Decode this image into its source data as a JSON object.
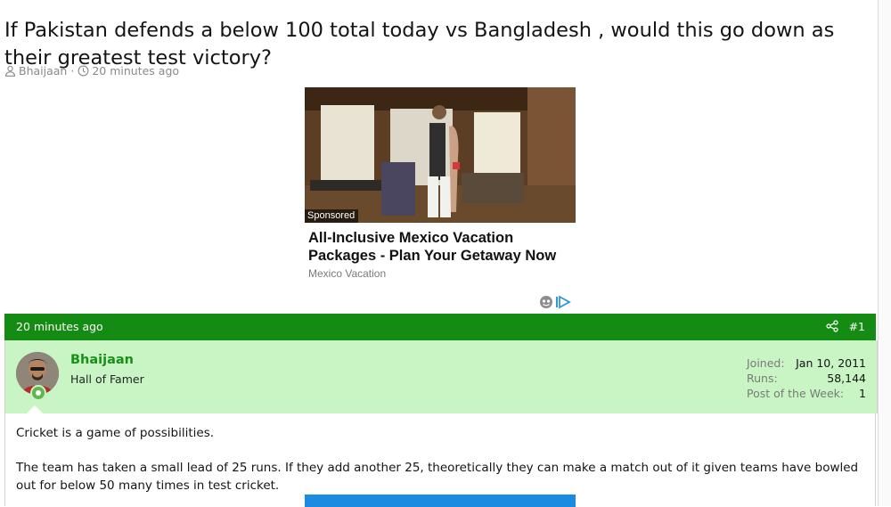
{
  "thread": {
    "title": "If Pakistan defends a below 100 total today vs Bangladesh , would this go down as their greatest test victory?",
    "author": "Bhaijaan",
    "separator": "·",
    "time": "20 minutes ago"
  },
  "ad": {
    "sponsored_label": "Sponsored",
    "headline": "All-Inclusive Mexico Vacation Packages - Plan Your Getaway Now",
    "source": "Mexico Vacation"
  },
  "post": {
    "time": "20 minutes ago",
    "number": "#1",
    "user": {
      "name": "Bhaijaan",
      "title": "Hall of Famer",
      "stats": [
        {
          "label": "Joined:",
          "value": "Jan 10, 2011"
        },
        {
          "label": "Runs:",
          "value": "58,144"
        },
        {
          "label": "Post of the Week:",
          "value": "1"
        }
      ]
    },
    "body": {
      "p1": "Cricket is a game of possibilities.",
      "p2": "The team has taken a small lead of 25 runs. If they add another 25, theoretically they can make a match out of it given teams have bowled out for below 50 many times in test cricket."
    }
  },
  "colors": {
    "header_green": "#148c14",
    "user_panel_green": "#c9f5c4",
    "username_green": "#188f18"
  },
  "icons": [
    "user-icon",
    "clock-icon",
    "share-icon",
    "ad-choices-icon"
  ]
}
